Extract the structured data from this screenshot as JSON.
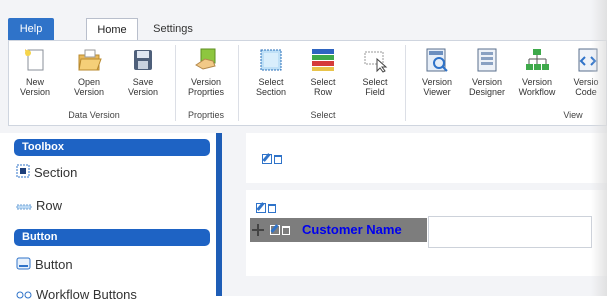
{
  "tabs": [
    {
      "label": "Help"
    },
    {
      "label": "Home"
    },
    {
      "label": "Settings"
    }
  ],
  "ribbon": {
    "buttons": [
      {
        "line1": "New",
        "line2": "Version",
        "icon": "new-version-icon"
      },
      {
        "line1": "Open",
        "line2": "Version",
        "icon": "open-folder-icon"
      },
      {
        "line1": "Save",
        "line2": "Version",
        "icon": "save-icon"
      },
      {
        "line1": "Version",
        "line2": "Proprties",
        "icon": "properties-hand-icon"
      },
      {
        "line1": "Select",
        "line2": "Section",
        "icon": "select-section-icon"
      },
      {
        "line1": "Select",
        "line2": "Row",
        "icon": "select-row-icon"
      },
      {
        "line1": "Select",
        "line2": "Field",
        "icon": "select-field-icon"
      },
      {
        "line1": "Version",
        "line2": "Viewer",
        "icon": "viewer-icon"
      },
      {
        "line1": "Version",
        "line2": "Designer",
        "icon": "designer-icon"
      },
      {
        "line1": "Version",
        "line2": "Workflow",
        "icon": "workflow-icon"
      },
      {
        "line1": "Versio",
        "line2": "Code",
        "icon": "code-icon"
      }
    ],
    "groups": [
      {
        "label": "Data Version"
      },
      {
        "label": "Proprties"
      },
      {
        "label": "Select"
      },
      {
        "label": "View"
      }
    ]
  },
  "toolbox": {
    "header": "Toolbox",
    "items": [
      {
        "label": "Section",
        "icon": "section-icon"
      },
      {
        "label": "Row",
        "icon": "row-icon"
      }
    ],
    "button_header": "Button",
    "button_items": [
      {
        "label": "Button",
        "icon": "button-icon"
      },
      {
        "label": "Workflow Buttons",
        "icon": "workflow-buttons-icon"
      }
    ]
  },
  "canvas": {
    "field_label": "Customer Name"
  },
  "colors": {
    "accent": "#2f73c9",
    "header_blue": "#1e63c4",
    "field_label_blue": "#0000ee"
  }
}
